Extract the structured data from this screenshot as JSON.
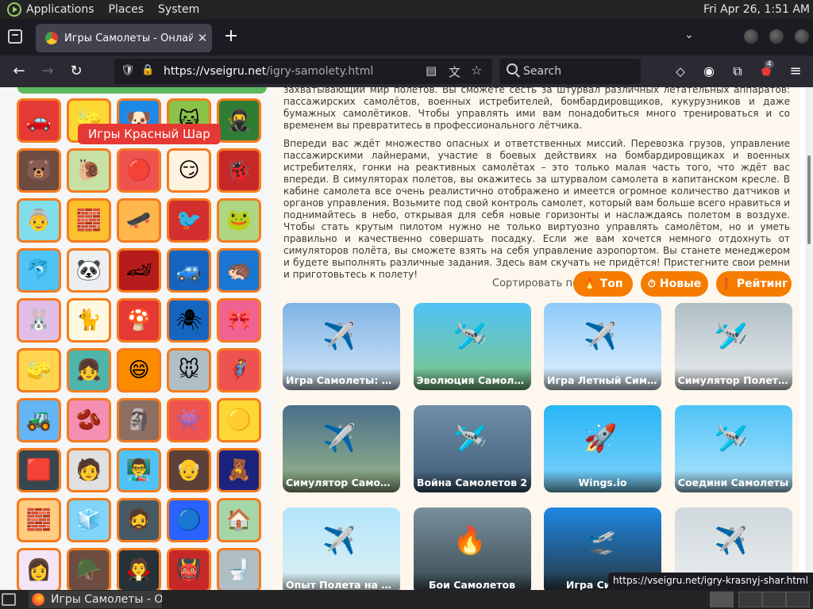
{
  "system_panel": {
    "menus": [
      "Applications",
      "Places",
      "System"
    ],
    "clock": "Fri Apr 26,  1:51 AM"
  },
  "browser": {
    "tab_title": "Игры Самолеты - Онлайн",
    "tab_close": "✕",
    "new_tab": "+",
    "url_host": "https://vseigru.net",
    "url_path": "/igry-samolety.html",
    "search_placeholder": "Search",
    "extension_badge": "4"
  },
  "sidebar": {
    "tooltip": "Игры Красный Шар",
    "thumbs": [
      {
        "color": "#e53935",
        "icon": "🚗"
      },
      {
        "color": "#fdd835",
        "icon": "🧽"
      },
      {
        "color": "#1e88e5",
        "icon": "🐶"
      },
      {
        "color": "#8bc34a",
        "icon": "🐱"
      },
      {
        "color": "#2e7d32",
        "icon": "🥷"
      },
      {
        "color": "#6d4c41",
        "icon": "🐻"
      },
      {
        "color": "#c5e1a5",
        "icon": "🐌"
      },
      {
        "color": "#ef5350",
        "icon": "🔴"
      },
      {
        "color": "#fff3e0",
        "icon": "😏"
      },
      {
        "color": "#c62828",
        "icon": "🐞"
      },
      {
        "color": "#80deea",
        "icon": "👵"
      },
      {
        "color": "#fbc02d",
        "icon": "🧱"
      },
      {
        "color": "#ffb74d",
        "icon": "🛹"
      },
      {
        "color": "#d32f2f",
        "icon": "🐦"
      },
      {
        "color": "#aed581",
        "icon": "🐸"
      },
      {
        "color": "#4fc3f7",
        "icon": "🐬"
      },
      {
        "color": "#eceff1",
        "icon": "🐼"
      },
      {
        "color": "#b71c1c",
        "icon": "🏎"
      },
      {
        "color": "#1565c0",
        "icon": "🚙"
      },
      {
        "color": "#1976d2",
        "icon": "🦔"
      },
      {
        "color": "#e1bee7",
        "icon": "🐰"
      },
      {
        "color": "#fff8e1",
        "icon": "🐈"
      },
      {
        "color": "#e53935",
        "icon": "🍄"
      },
      {
        "color": "#1565c0",
        "icon": "🕷"
      },
      {
        "color": "#f06292",
        "icon": "🎀"
      },
      {
        "color": "#ffd54f",
        "icon": "🧽"
      },
      {
        "color": "#4db6ac",
        "icon": "👧"
      },
      {
        "color": "#fb8c00",
        "icon": "😄"
      },
      {
        "color": "#b0bec5",
        "icon": "🐭"
      },
      {
        "color": "#ef5350",
        "icon": "🦸"
      },
      {
        "color": "#64b5f6",
        "icon": "🚜"
      },
      {
        "color": "#f48fb1",
        "icon": "🫘"
      },
      {
        "color": "#8d6e63",
        "icon": "🗿"
      },
      {
        "color": "#ef5350",
        "icon": "👾"
      },
      {
        "color": "#fdd835",
        "icon": "🟡"
      },
      {
        "color": "#37474f",
        "icon": "🟥"
      },
      {
        "color": "#e0e0e0",
        "icon": "🧑"
      },
      {
        "color": "#4fc3f7",
        "icon": "👨‍🏫"
      },
      {
        "color": "#5d4037",
        "icon": "👴"
      },
      {
        "color": "#1a237e",
        "icon": "🧸"
      },
      {
        "color": "#ffcc80",
        "icon": "🧱"
      },
      {
        "color": "#81d4fa",
        "icon": "🧊"
      },
      {
        "color": "#455a64",
        "icon": "🧔"
      },
      {
        "color": "#2962ff",
        "icon": "🔵"
      },
      {
        "color": "#a5d6a7",
        "icon": "🏠"
      },
      {
        "color": "#f3e5f5",
        "icon": "👩"
      },
      {
        "color": "#6d4c41",
        "icon": "🪖"
      },
      {
        "color": "#263238",
        "icon": "🧛"
      },
      {
        "color": "#c62828",
        "icon": "👹"
      },
      {
        "color": "#b0bec5",
        "icon": "🚽"
      }
    ]
  },
  "content": {
    "paragraph1": "захватывающий мир полётов. Вы сможете сесть за штурвал различных летательных аппаратов: пассажирских самолётов, военных истребителей, бомбардировщиков, кукурузников и даже бумажных самолётиков. Чтобы управлять ими вам понадобиться много тренироваться и со временем вы превратитесь в профессионального лётчика.",
    "paragraph2": "Впереди вас ждёт множество опасных и ответственных миссий. Перевозка грузов, управление пассажирскими лайнерами, участие в боевых действиях на бомбардировщиках и военных истребителях, гонки на реактивных самолётах – это только малая часть того, что ждёт вас впереди. В симуляторах полетов, вы окажитесь за штурвалом самолета в капитанском кресле. В кабине самолета все очень реалистично отображено и имеется огромное количество датчиков и органов управления. Возьмите под свой контроль самолет, который вам больше всего нравиться и поднимайтесь в небо, открывая для себя новые горизонты и наслаждаясь полетом в воздухе. Чтобы стать крутым пилотом нужно не только виртуозно управлять самолётом, но и уметь правильно и качественно совершать посадку. Если же вам хочется немного отдохнуть от симуляторов полёта, вы сможете взять на себя управление аэропортом. Вы станете менеджером и будете выполнять различные задания. Здесь вам скучать не придётся! Пристегните свои ремни и приготовьтесь к полету!",
    "sort_label": "Сортировать по:",
    "sort_buttons": [
      {
        "label": "Топ",
        "icon": "🔥"
      },
      {
        "label": "Новые",
        "icon": "⏱"
      },
      {
        "label": "Рейтинг",
        "icon": "❗"
      }
    ],
    "cards": [
      {
        "title": "Игра Самолеты: Бо...",
        "bg": "linear-gradient(#7fb3e6,#d7e9f7)",
        "icon": "✈️"
      },
      {
        "title": "Эволюция Самолёта",
        "bg": "linear-gradient(#4fc3f7,#81c784)",
        "icon": "🛩️"
      },
      {
        "title": "Игра Летный Симул...",
        "bg": "linear-gradient(#90caf9,#e3f2fd)",
        "icon": "✈️"
      },
      {
        "title": "Симулятор Полетов...",
        "bg": "linear-gradient(#b0bec5,#eceff1)",
        "icon": "🛩️"
      },
      {
        "title": "Симулятор Самоле...",
        "bg": "linear-gradient(#4a6f8a,#9cb98a)",
        "icon": "✈️"
      },
      {
        "title": "Война Самолетов 2",
        "bg": "linear-gradient(#6f8fa8,#3e5b74)",
        "icon": "🛩️"
      },
      {
        "title": "Wings.io",
        "bg": "linear-gradient(#29b6f6,#81d4fa)",
        "icon": "🚀"
      },
      {
        "title": "Соедини Самолеты",
        "bg": "linear-gradient(#4fc3f7,#b3e5fc)",
        "icon": "🛩️"
      },
      {
        "title": "Опыт Полета на Са...",
        "bg": "linear-gradient(#b3e5fc,#e0f2f1)",
        "icon": "✈️"
      },
      {
        "title": "Бои Самолетов",
        "bg": "linear-gradient(#78909c,#37474f)",
        "icon": "🔥"
      },
      {
        "title": "Игра Симуля",
        "bg": "linear-gradient(#1e88e5,#263238)",
        "icon": "🛫"
      },
      {
        "title": "",
        "bg": "linear-gradient(#cfd8dc,#eceff1)",
        "icon": "✈️"
      }
    ]
  },
  "status_link": "https://vseigru.net/igry-krasnyj-shar.html",
  "taskbar": {
    "task_title": "Игры Самолеты - О..."
  }
}
